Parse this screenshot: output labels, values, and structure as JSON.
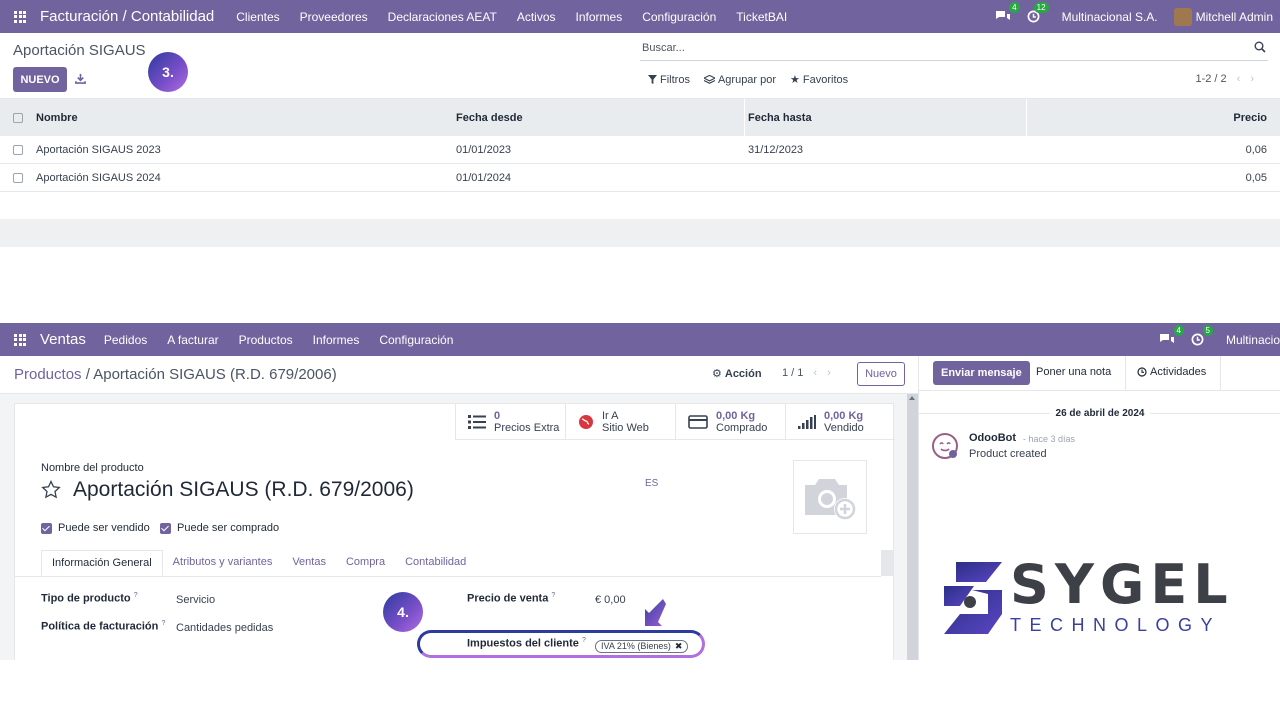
{
  "top_nav": {
    "app_name": "Facturación / Contabilidad",
    "menu": [
      "Clientes",
      "Proveedores",
      "Declaraciones AEAT",
      "Activos",
      "Informes",
      "Configuración",
      "TicketBAI"
    ],
    "messages_count": "4",
    "activities_count": "12",
    "company": "Multinacional S.A.",
    "user": "Mitchell Admin"
  },
  "list_view": {
    "title": "Aportación SIGAUS",
    "new_button": "NUEVO",
    "search_placeholder": "Buscar...",
    "filters": "Filtros",
    "group_by": "Agrupar por",
    "favorites": "Favoritos",
    "pager": "1-2 / 2",
    "columns": [
      "Nombre",
      "Fecha desde",
      "Fecha hasta",
      "Precio"
    ],
    "rows": [
      [
        "Aportación SIGAUS 2023",
        "01/01/2023",
        "31/12/2023",
        "0,06"
      ],
      [
        "Aportación SIGAUS 2024",
        "01/01/2024",
        "",
        "0,05"
      ]
    ]
  },
  "steps": {
    "step3": "3.",
    "step4": "4."
  },
  "sales_nav": {
    "app_name": "Ventas",
    "menu": [
      "Pedidos",
      "A facturar",
      "Productos",
      "Informes",
      "Configuración"
    ],
    "messages_count": "4",
    "activities_count": "5",
    "company": "Multinacio"
  },
  "form": {
    "breadcrumb_parent": "Productos",
    "breadcrumb_sep": "/",
    "breadcrumb_current": "Aportación SIGAUS (R.D. 679/2006)",
    "action": "Acción",
    "pager": "1 / 1",
    "new_button": "Nuevo",
    "stats": [
      {
        "value": "0",
        "label": "Precios Extra"
      },
      {
        "value": "Ir A",
        "label": "Sitio Web"
      },
      {
        "value": "0,00 Kg",
        "label": "Comprado"
      },
      {
        "value": "0,00 Kg",
        "label": "Vendido"
      }
    ],
    "product_name_label": "Nombre del producto",
    "product_name": "Aportación SIGAUS (R.D. 679/2006)",
    "lang": "ES",
    "can_be_sold": "Puede ser vendido",
    "can_be_purchased": "Puede ser comprado",
    "tabs": [
      "Información General",
      "Atributos y variantes",
      "Ventas",
      "Compra",
      "Contabilidad"
    ],
    "product_type_label": "Tipo de producto",
    "product_type": "Servicio",
    "invoice_policy_label": "Política de facturación",
    "invoice_policy": "Cantidades pedidas",
    "sale_price_label": "Precio de venta",
    "sale_price": "€ 0,00",
    "customer_taxes_label": "Impuestos del cliente",
    "customer_tax_tag": "IVA 21% (Bienes)",
    "help_mark": "?"
  },
  "chatter": {
    "send_message": "Enviar mensaje",
    "log_note": "Poner una nota",
    "activities": "Actividades",
    "date": "26 de abril de 2024",
    "author": "OdooBot",
    "time": "- hace 3 días",
    "body": "Product created"
  },
  "logo": {
    "word": "SYGEL",
    "sub": "TECHNOLOGY"
  },
  "colors": {
    "brand": "#71639e",
    "badge": "#28a745"
  }
}
